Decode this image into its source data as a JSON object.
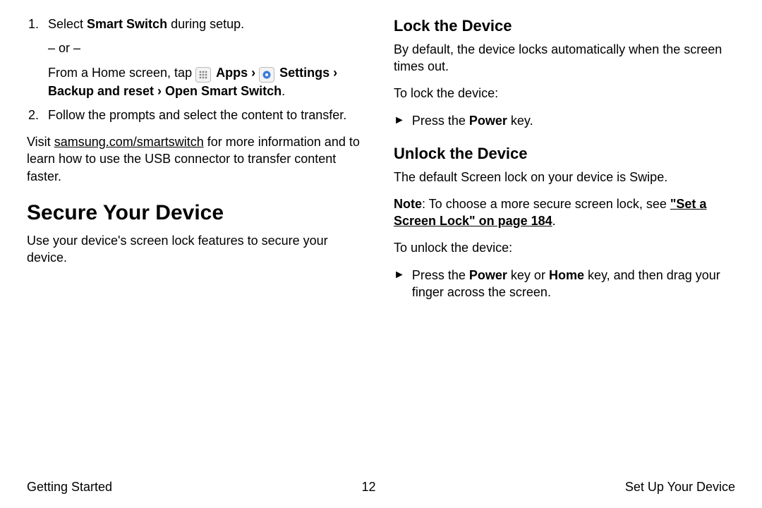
{
  "left": {
    "step1_prefix": "Select ",
    "step1_bold": "Smart Switch",
    "step1_suffix": " during setup.",
    "or": "– or –",
    "from_prefix": "From a Home screen, tap ",
    "apps": "Apps",
    "caret1": " › ",
    "settings": "Settings",
    "caret2": " › ",
    "backup_reset": "Backup and reset › Open Smart Switch",
    "period": ".",
    "step2": "Follow the prompts and select the content to transfer.",
    "visit_prefix": "Visit ",
    "visit_link": "samsung.com/smartswitch",
    "visit_suffix": " for more information and to learn how to use the USB connector to transfer content faster.",
    "h_secure": "Secure Your Device",
    "secure_desc": "Use your device's screen lock features to secure your device."
  },
  "right": {
    "h_lock": "Lock the Device",
    "lock_desc": "By default, the device locks automatically when the screen times out.",
    "lock_howto": "To lock the device:",
    "press_prefix": "Press the ",
    "power": "Power",
    "press_suffix": " key.",
    "h_unlock": "Unlock the Device",
    "unlock_desc": "The default Screen lock on your device is Swipe.",
    "note_label": "Note",
    "note_text": ": To choose a more secure screen lock, see ",
    "note_link": "\"Set a Screen Lock\" on page 184",
    "note_period": ".",
    "unlock_howto": "To unlock the device:",
    "unlock_press_prefix": "Press the ",
    "unlock_power": "Power",
    "unlock_mid": " key or ",
    "unlock_home": "Home",
    "unlock_suffix": " key, and then drag your finger across the screen."
  },
  "footer": {
    "left": "Getting Started",
    "center": "12",
    "right": "Set Up Your Device"
  },
  "markers": {
    "arrow": "►"
  }
}
